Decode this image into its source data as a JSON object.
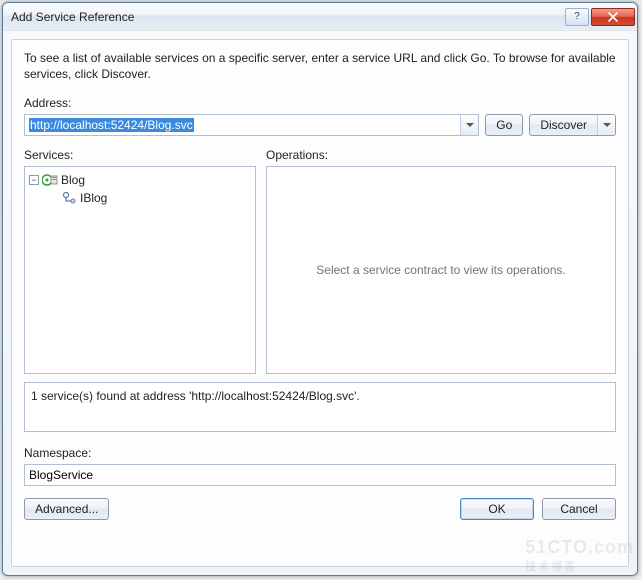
{
  "window": {
    "title": "Add Service Reference",
    "help_tooltip": "?",
    "close_tooltip": "Close"
  },
  "instructions": "To see a list of available services on a specific server, enter a service URL and click Go. To browse for available services, click Discover.",
  "address": {
    "label": "Address:",
    "value": "http://localhost:52424/Blog.svc",
    "go_label": "Go",
    "discover_label": "Discover"
  },
  "services": {
    "label": "Services:",
    "tree": {
      "root": {
        "label": "Blog",
        "expanded": true
      },
      "child": {
        "label": "IBlog"
      }
    }
  },
  "operations": {
    "label": "Operations:",
    "placeholder": "Select a service contract to view its operations."
  },
  "status": "1 service(s) found at address 'http://localhost:52424/Blog.svc'.",
  "namespace": {
    "label": "Namespace:",
    "value": "BlogService"
  },
  "buttons": {
    "advanced": "Advanced...",
    "ok": "OK",
    "cancel": "Cancel"
  },
  "watermark": {
    "line1": "51CTO.com",
    "line2": "技术博客"
  }
}
